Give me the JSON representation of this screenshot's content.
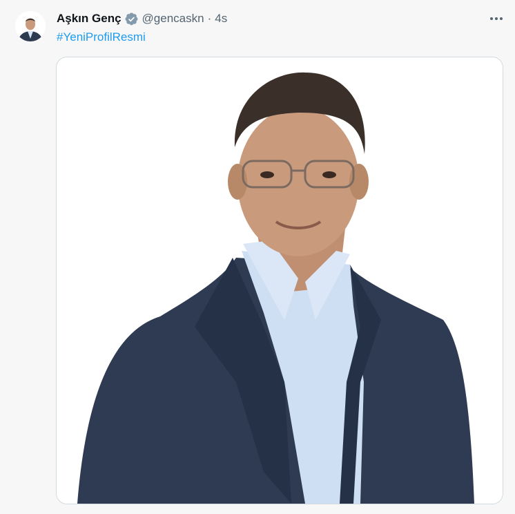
{
  "tweet": {
    "author_name": "Aşkın Genç",
    "handle": "@gencaskn",
    "separator": "·",
    "time": "4s",
    "hashtag": "#YeniProfilResmi",
    "more_icon": "more-horizontal-icon",
    "verified_icon": "verified-badge-icon"
  },
  "colors": {
    "link": "#1d9bf0",
    "secondary_text": "#536471",
    "background": "#f7f7f7"
  }
}
